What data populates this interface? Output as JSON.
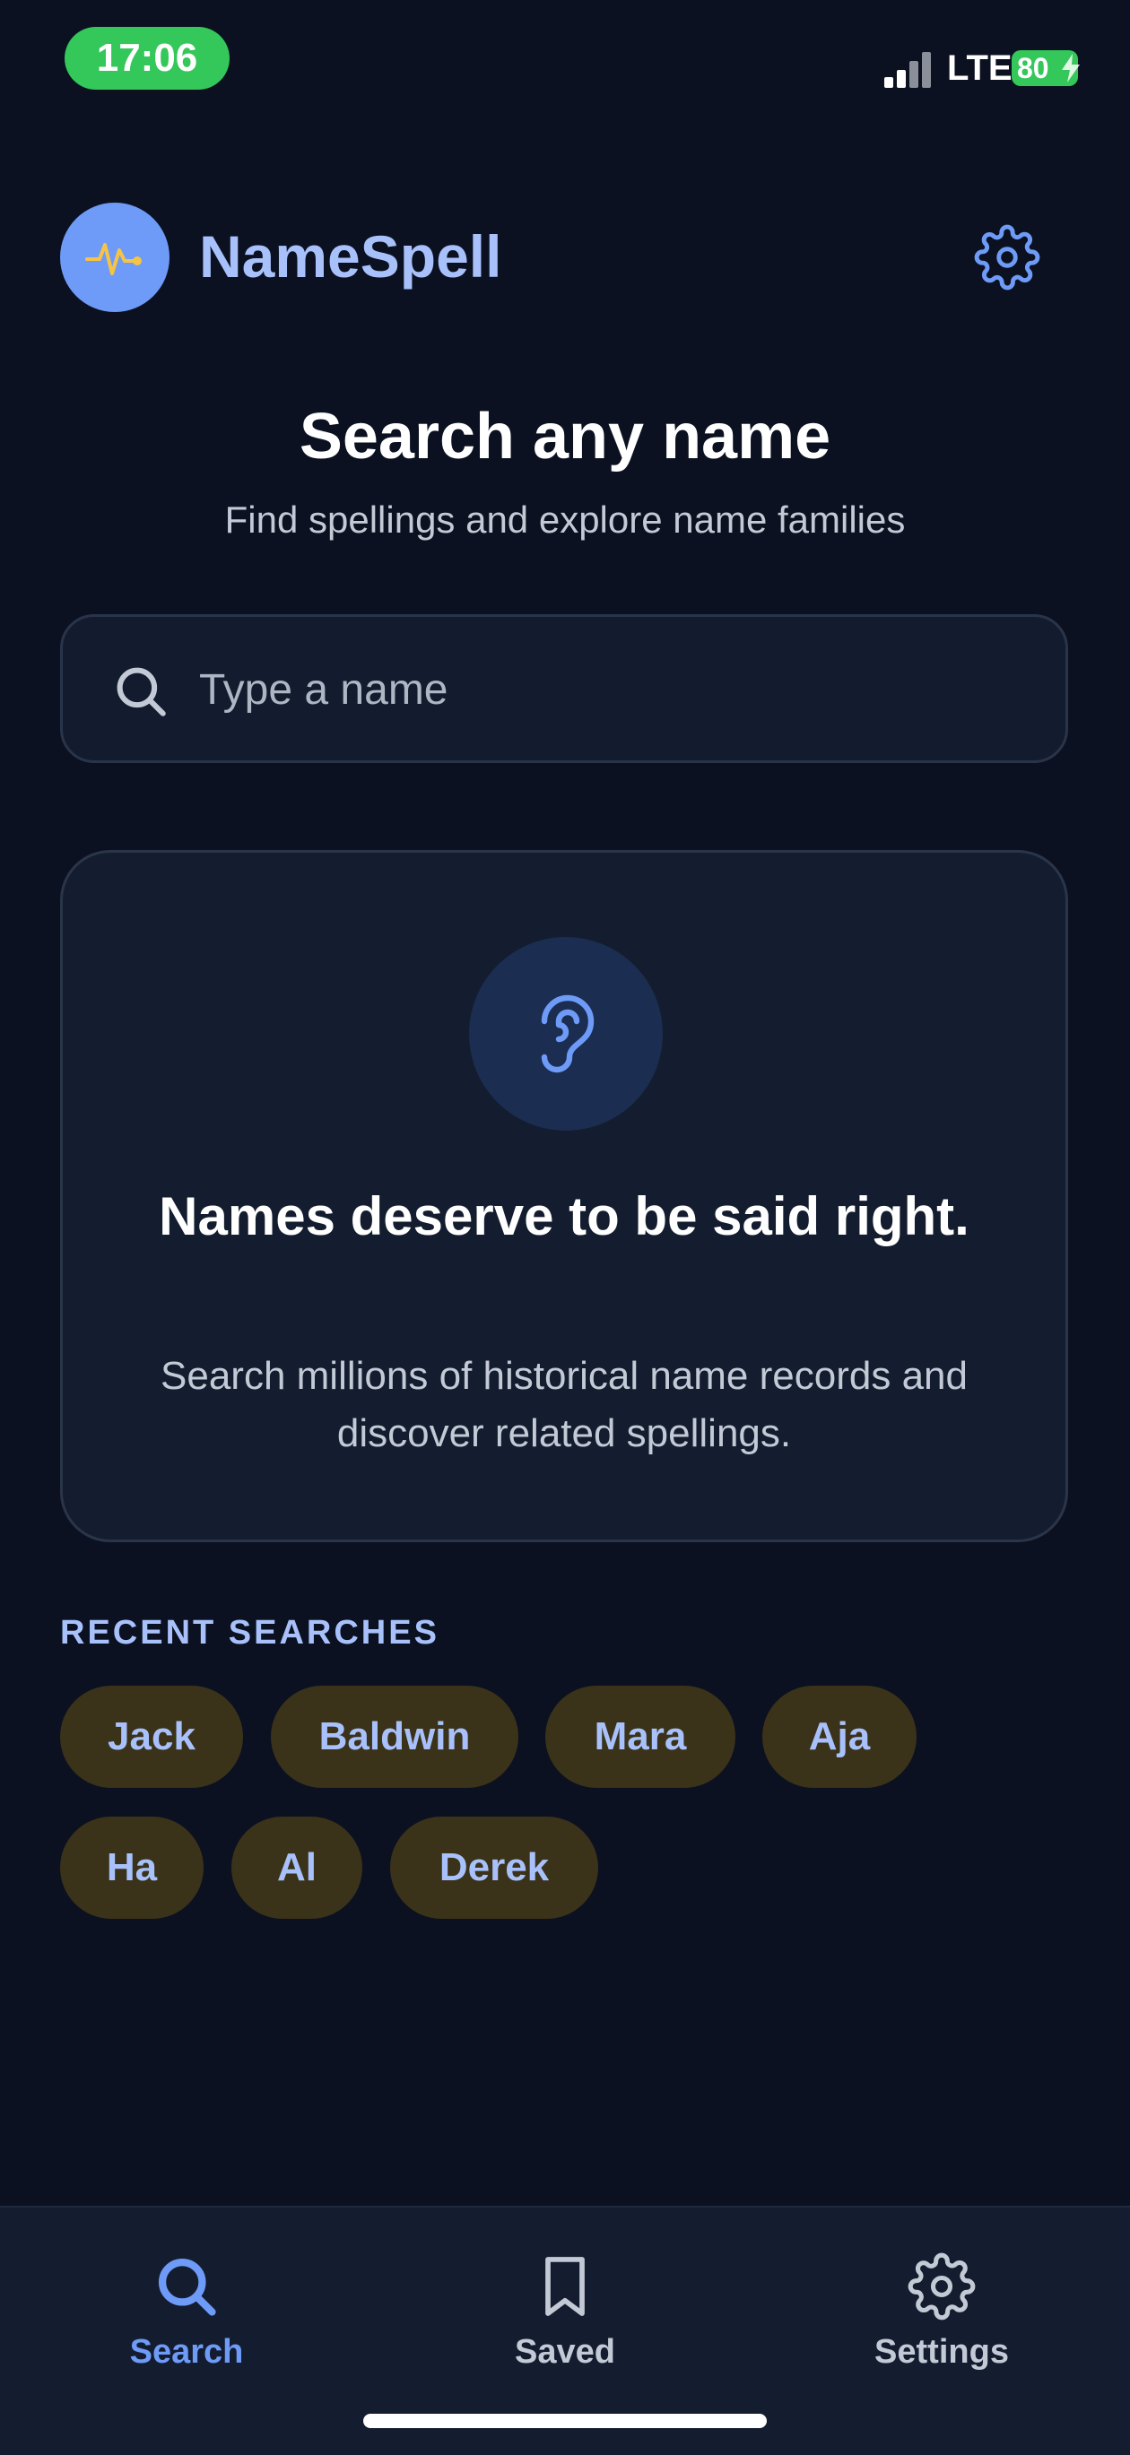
{
  "status_bar": {
    "time": "17:06",
    "network": "LTE",
    "battery": "80"
  },
  "header": {
    "app_name": "NameSpell",
    "logo_icon": "waveform-icon",
    "settings_icon": "gear-icon"
  },
  "hero": {
    "title": "Search any name",
    "subtitle": "Find spellings and explore name families"
  },
  "search": {
    "placeholder": "Type a name",
    "value": ""
  },
  "info_card": {
    "icon": "ear-icon",
    "title": "Names deserve to be said right.",
    "body": "Search millions of historical name records and discover related spellings."
  },
  "recent": {
    "label": "RECENT SEARCHES",
    "items": [
      "Jack",
      "Baldwin",
      "Mara",
      "Aja",
      "Ha",
      "Al",
      "Derek"
    ]
  },
  "tabbar": {
    "tabs": [
      {
        "label": "Search",
        "icon": "search-icon",
        "active": true
      },
      {
        "label": "Saved",
        "icon": "bookmark-icon",
        "active": false
      },
      {
        "label": "Settings",
        "icon": "gear-icon",
        "active": false
      }
    ]
  },
  "colors": {
    "background": "#0b1120",
    "accent": "#6e9bf7",
    "accent_text": "#a9c1fb",
    "chip_bg": "#3a3219",
    "inactive_tab": "#c3cad6"
  }
}
